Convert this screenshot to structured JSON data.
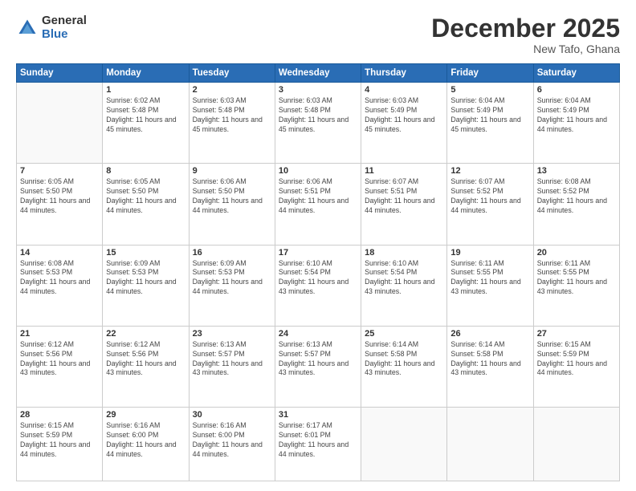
{
  "logo": {
    "general": "General",
    "blue": "Blue"
  },
  "header": {
    "month": "December 2025",
    "location": "New Tafo, Ghana"
  },
  "days_of_week": [
    "Sunday",
    "Monday",
    "Tuesday",
    "Wednesday",
    "Thursday",
    "Friday",
    "Saturday"
  ],
  "weeks": [
    [
      {
        "day": "",
        "sunrise": "",
        "sunset": "",
        "daylight": ""
      },
      {
        "day": "1",
        "sunrise": "Sunrise: 6:02 AM",
        "sunset": "Sunset: 5:48 PM",
        "daylight": "Daylight: 11 hours and 45 minutes."
      },
      {
        "day": "2",
        "sunrise": "Sunrise: 6:03 AM",
        "sunset": "Sunset: 5:48 PM",
        "daylight": "Daylight: 11 hours and 45 minutes."
      },
      {
        "day": "3",
        "sunrise": "Sunrise: 6:03 AM",
        "sunset": "Sunset: 5:48 PM",
        "daylight": "Daylight: 11 hours and 45 minutes."
      },
      {
        "day": "4",
        "sunrise": "Sunrise: 6:03 AM",
        "sunset": "Sunset: 5:49 PM",
        "daylight": "Daylight: 11 hours and 45 minutes."
      },
      {
        "day": "5",
        "sunrise": "Sunrise: 6:04 AM",
        "sunset": "Sunset: 5:49 PM",
        "daylight": "Daylight: 11 hours and 45 minutes."
      },
      {
        "day": "6",
        "sunrise": "Sunrise: 6:04 AM",
        "sunset": "Sunset: 5:49 PM",
        "daylight": "Daylight: 11 hours and 44 minutes."
      }
    ],
    [
      {
        "day": "7",
        "sunrise": "Sunrise: 6:05 AM",
        "sunset": "Sunset: 5:50 PM",
        "daylight": "Daylight: 11 hours and 44 minutes."
      },
      {
        "day": "8",
        "sunrise": "Sunrise: 6:05 AM",
        "sunset": "Sunset: 5:50 PM",
        "daylight": "Daylight: 11 hours and 44 minutes."
      },
      {
        "day": "9",
        "sunrise": "Sunrise: 6:06 AM",
        "sunset": "Sunset: 5:50 PM",
        "daylight": "Daylight: 11 hours and 44 minutes."
      },
      {
        "day": "10",
        "sunrise": "Sunrise: 6:06 AM",
        "sunset": "Sunset: 5:51 PM",
        "daylight": "Daylight: 11 hours and 44 minutes."
      },
      {
        "day": "11",
        "sunrise": "Sunrise: 6:07 AM",
        "sunset": "Sunset: 5:51 PM",
        "daylight": "Daylight: 11 hours and 44 minutes."
      },
      {
        "day": "12",
        "sunrise": "Sunrise: 6:07 AM",
        "sunset": "Sunset: 5:52 PM",
        "daylight": "Daylight: 11 hours and 44 minutes."
      },
      {
        "day": "13",
        "sunrise": "Sunrise: 6:08 AM",
        "sunset": "Sunset: 5:52 PM",
        "daylight": "Daylight: 11 hours and 44 minutes."
      }
    ],
    [
      {
        "day": "14",
        "sunrise": "Sunrise: 6:08 AM",
        "sunset": "Sunset: 5:53 PM",
        "daylight": "Daylight: 11 hours and 44 minutes."
      },
      {
        "day": "15",
        "sunrise": "Sunrise: 6:09 AM",
        "sunset": "Sunset: 5:53 PM",
        "daylight": "Daylight: 11 hours and 44 minutes."
      },
      {
        "day": "16",
        "sunrise": "Sunrise: 6:09 AM",
        "sunset": "Sunset: 5:53 PM",
        "daylight": "Daylight: 11 hours and 44 minutes."
      },
      {
        "day": "17",
        "sunrise": "Sunrise: 6:10 AM",
        "sunset": "Sunset: 5:54 PM",
        "daylight": "Daylight: 11 hours and 43 minutes."
      },
      {
        "day": "18",
        "sunrise": "Sunrise: 6:10 AM",
        "sunset": "Sunset: 5:54 PM",
        "daylight": "Daylight: 11 hours and 43 minutes."
      },
      {
        "day": "19",
        "sunrise": "Sunrise: 6:11 AM",
        "sunset": "Sunset: 5:55 PM",
        "daylight": "Daylight: 11 hours and 43 minutes."
      },
      {
        "day": "20",
        "sunrise": "Sunrise: 6:11 AM",
        "sunset": "Sunset: 5:55 PM",
        "daylight": "Daylight: 11 hours and 43 minutes."
      }
    ],
    [
      {
        "day": "21",
        "sunrise": "Sunrise: 6:12 AM",
        "sunset": "Sunset: 5:56 PM",
        "daylight": "Daylight: 11 hours and 43 minutes."
      },
      {
        "day": "22",
        "sunrise": "Sunrise: 6:12 AM",
        "sunset": "Sunset: 5:56 PM",
        "daylight": "Daylight: 11 hours and 43 minutes."
      },
      {
        "day": "23",
        "sunrise": "Sunrise: 6:13 AM",
        "sunset": "Sunset: 5:57 PM",
        "daylight": "Daylight: 11 hours and 43 minutes."
      },
      {
        "day": "24",
        "sunrise": "Sunrise: 6:13 AM",
        "sunset": "Sunset: 5:57 PM",
        "daylight": "Daylight: 11 hours and 43 minutes."
      },
      {
        "day": "25",
        "sunrise": "Sunrise: 6:14 AM",
        "sunset": "Sunset: 5:58 PM",
        "daylight": "Daylight: 11 hours and 43 minutes."
      },
      {
        "day": "26",
        "sunrise": "Sunrise: 6:14 AM",
        "sunset": "Sunset: 5:58 PM",
        "daylight": "Daylight: 11 hours and 43 minutes."
      },
      {
        "day": "27",
        "sunrise": "Sunrise: 6:15 AM",
        "sunset": "Sunset: 5:59 PM",
        "daylight": "Daylight: 11 hours and 44 minutes."
      }
    ],
    [
      {
        "day": "28",
        "sunrise": "Sunrise: 6:15 AM",
        "sunset": "Sunset: 5:59 PM",
        "daylight": "Daylight: 11 hours and 44 minutes."
      },
      {
        "day": "29",
        "sunrise": "Sunrise: 6:16 AM",
        "sunset": "Sunset: 6:00 PM",
        "daylight": "Daylight: 11 hours and 44 minutes."
      },
      {
        "day": "30",
        "sunrise": "Sunrise: 6:16 AM",
        "sunset": "Sunset: 6:00 PM",
        "daylight": "Daylight: 11 hours and 44 minutes."
      },
      {
        "day": "31",
        "sunrise": "Sunrise: 6:17 AM",
        "sunset": "Sunset: 6:01 PM",
        "daylight": "Daylight: 11 hours and 44 minutes."
      },
      {
        "day": "",
        "sunrise": "",
        "sunset": "",
        "daylight": ""
      },
      {
        "day": "",
        "sunrise": "",
        "sunset": "",
        "daylight": ""
      },
      {
        "day": "",
        "sunrise": "",
        "sunset": "",
        "daylight": ""
      }
    ]
  ]
}
